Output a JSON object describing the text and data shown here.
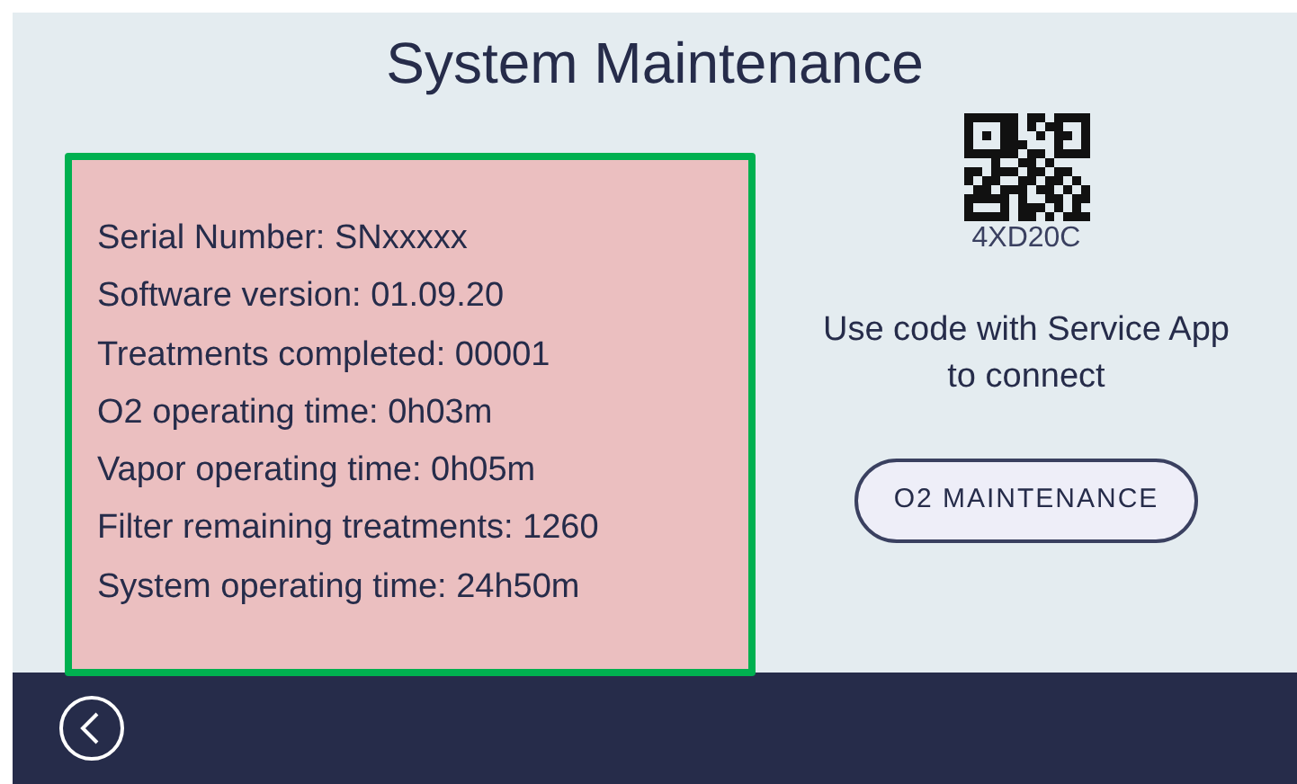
{
  "header": {
    "title": "System Maintenance"
  },
  "info_lines": [
    "Serial Number: SNxxxxx",
    "Software version: 01.09.20",
    "Treatments completed: 00001",
    "O2 operating time: 0h03m",
    "Vapor operating time: 0h05m",
    "Filter remaining treatments: 1260",
    "System operating time: 24h50m"
  ],
  "service": {
    "code": "4XD20C",
    "instruction": "Use code with Service App to connect",
    "button": "O2 MAINTENANCE"
  }
}
